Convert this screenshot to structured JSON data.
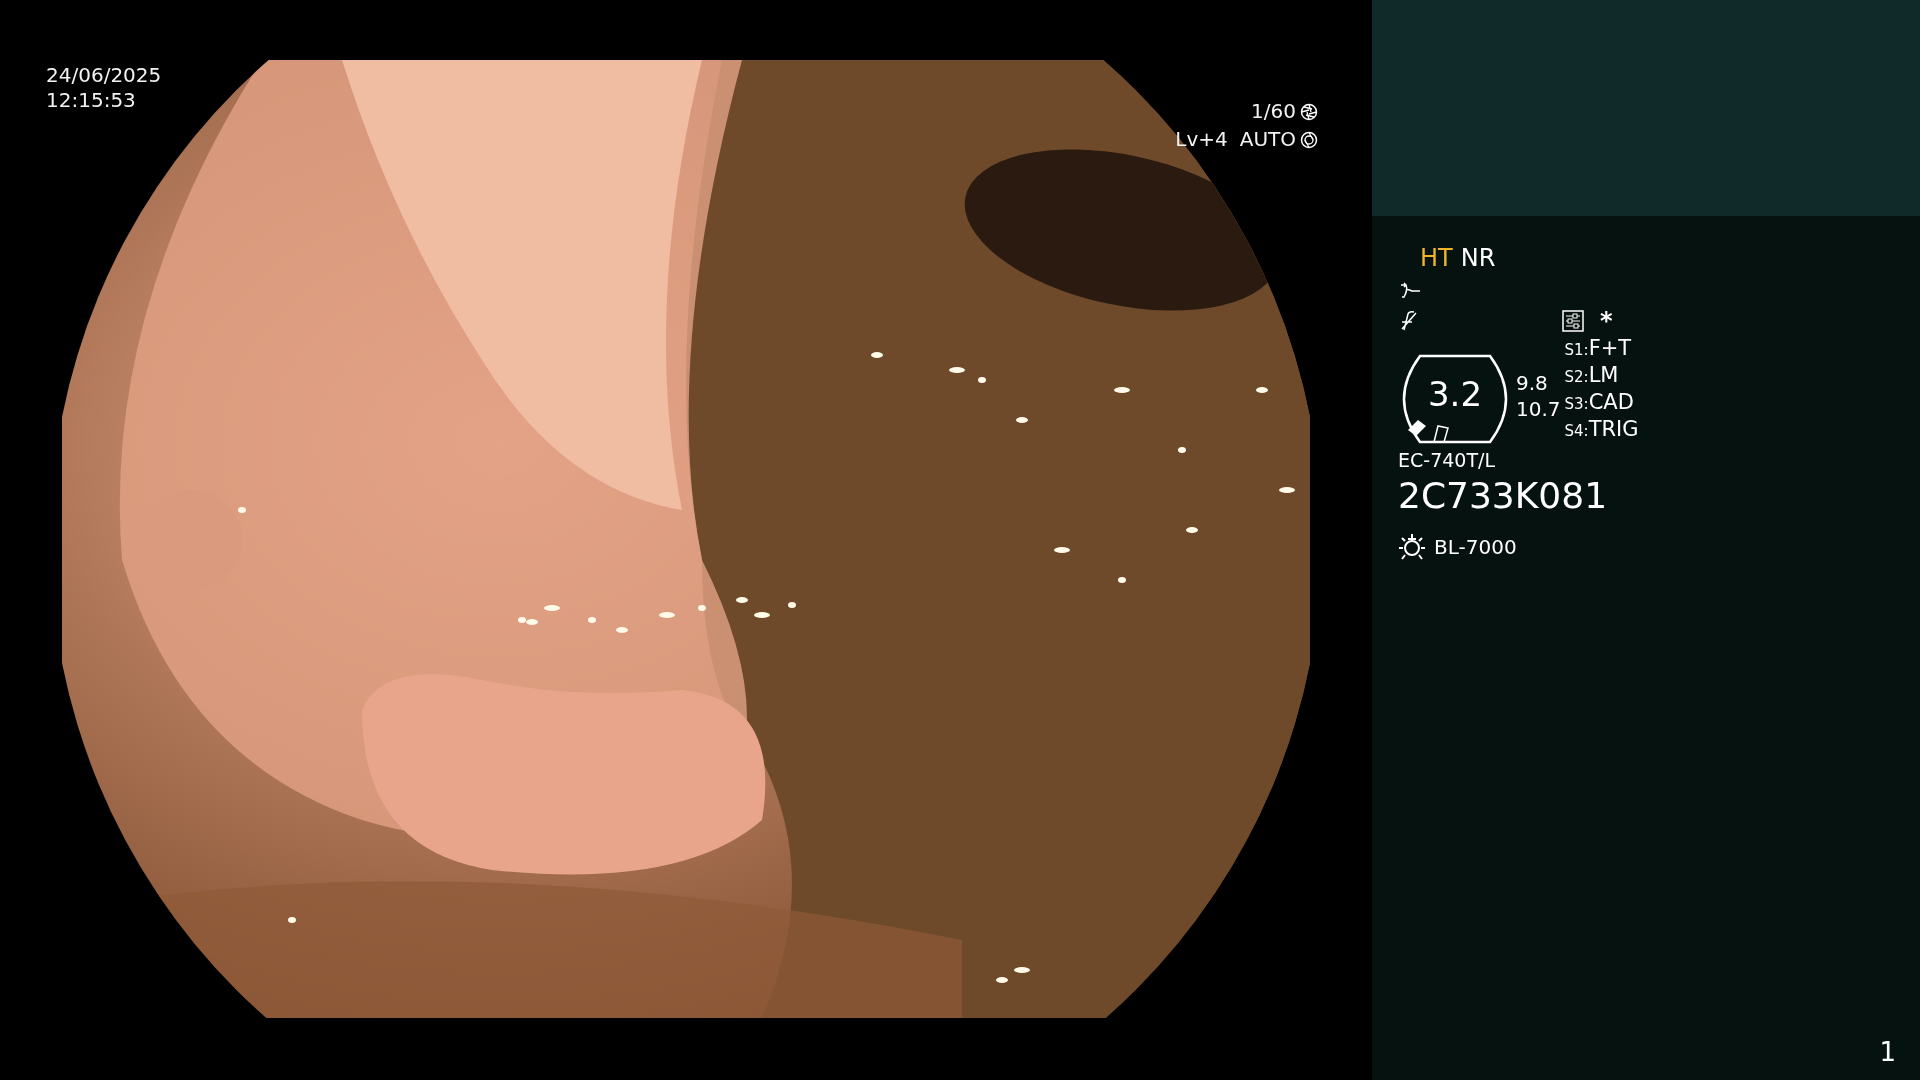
{
  "overlay": {
    "date": "24/06/2025",
    "time": "12:15:53",
    "shutter": "1/60",
    "exposure": "Lv+4",
    "iris_mode": "AUTO"
  },
  "panel": {
    "modes": [
      {
        "label": "HT",
        "color": "#f0b429"
      },
      {
        "label": "NR",
        "color": "#ffffff"
      }
    ],
    "settings_mark": "*",
    "zoom": "3.2",
    "readings": [
      "9.8",
      "10.7"
    ],
    "switches": [
      {
        "key": "S1:",
        "value": "F+T"
      },
      {
        "key": "S2:",
        "value": "LM"
      },
      {
        "key": "S3:",
        "value": "CAD"
      },
      {
        "key": "S4:",
        "value": "TRIG"
      }
    ],
    "scope_model": "EC-740T/L",
    "serial": "2C733K081",
    "light_source": "BL-7000"
  },
  "page_number": "1"
}
